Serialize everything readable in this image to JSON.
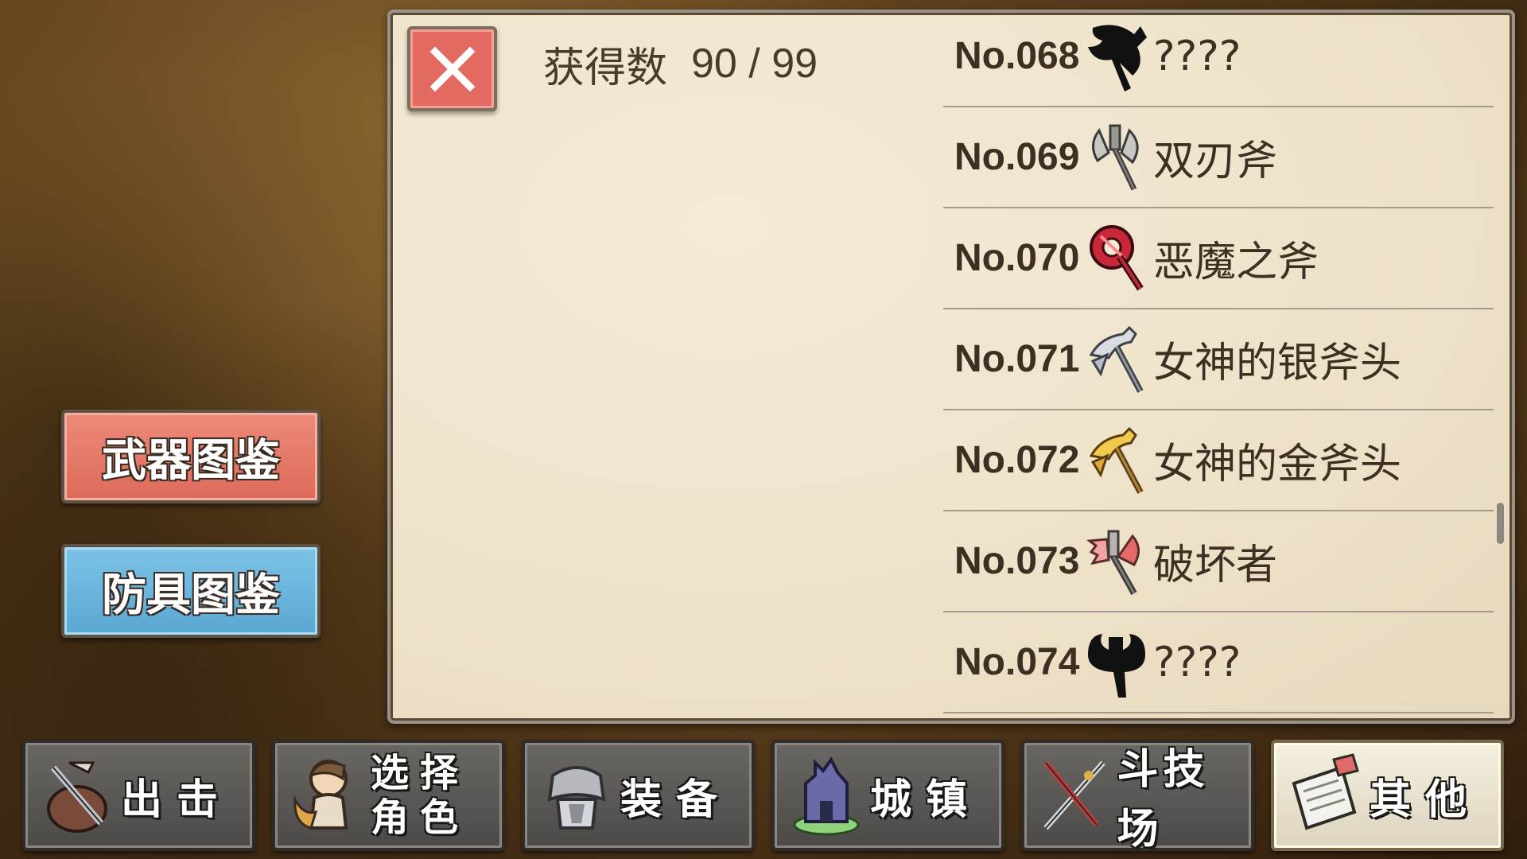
{
  "header": {
    "count_label": "获得数",
    "count_value": "90 / 99"
  },
  "side_buttons": {
    "weapon_catalog": "武器图鉴",
    "armor_catalog": "防具图鉴"
  },
  "items": [
    {
      "no": "No.068",
      "name": "????",
      "icon": "axe-silhouette-icon"
    },
    {
      "no": "No.069",
      "name": "双刃斧",
      "icon": "double-axe-icon"
    },
    {
      "no": "No.070",
      "name": "恶魔之斧",
      "icon": "demon-axe-icon"
    },
    {
      "no": "No.071",
      "name": "女神的银斧头",
      "icon": "silver-axe-icon"
    },
    {
      "no": "No.072",
      "name": "女神的金斧头",
      "icon": "gold-axe-icon"
    },
    {
      "no": "No.073",
      "name": "破坏者",
      "icon": "destroyer-axe-icon"
    },
    {
      "no": "No.074",
      "name": "????",
      "icon": "axe-silhouette-icon"
    }
  ],
  "nav": [
    {
      "label": "出击",
      "icon": "sortie-icon"
    },
    {
      "label_line1": "选择",
      "label_line2": "角色",
      "icon": "character-icon"
    },
    {
      "label": "装备",
      "icon": "equipment-icon"
    },
    {
      "label": "城镇",
      "icon": "town-icon"
    },
    {
      "label": "斗技场",
      "icon": "arena-icon"
    },
    {
      "label": "其他",
      "icon": "other-icon",
      "active": true
    }
  ],
  "colors": {
    "weapon_button": "#dc6a5a",
    "armor_button": "#5aa7d3",
    "close_button": "#e26a61"
  }
}
